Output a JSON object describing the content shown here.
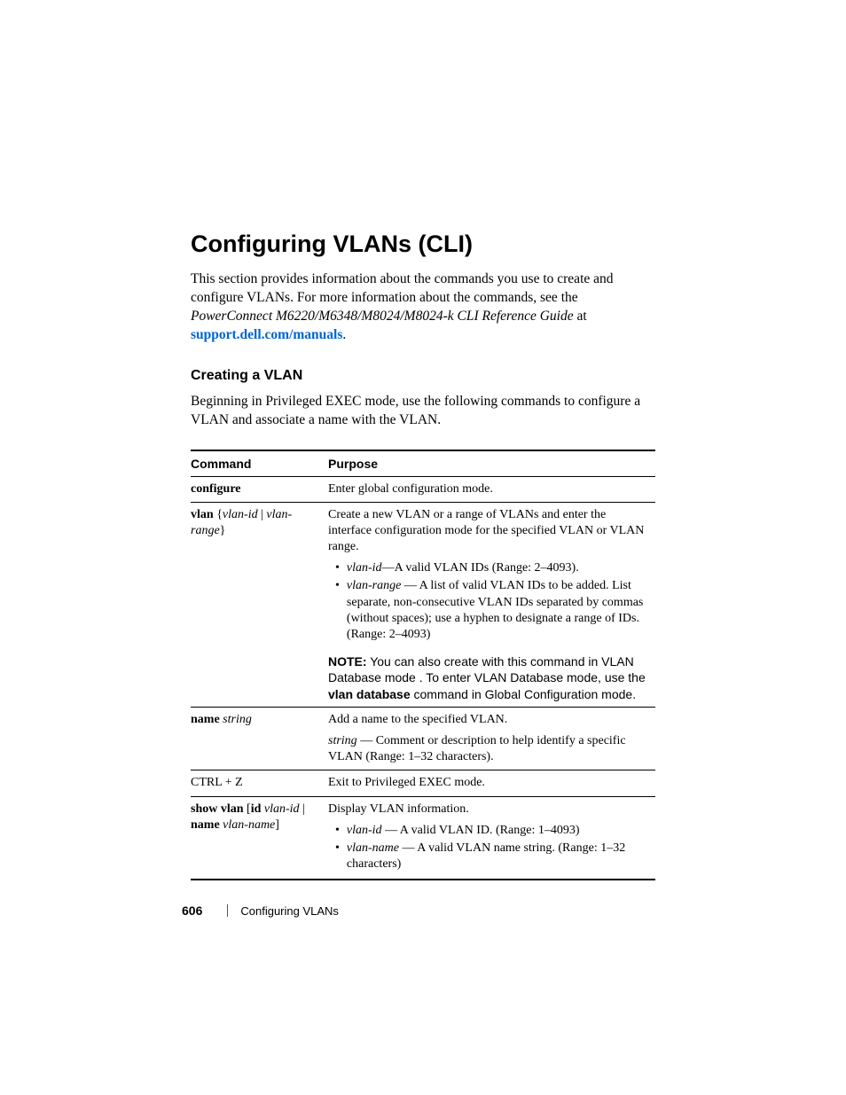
{
  "heading": "Configuring VLANs (CLI)",
  "intro": {
    "line1": "This section provides information about the commands you use to create and configure VLANs. For more information about the commands, see the ",
    "ref_italic": "PowerConnect M6220/M6348/M8024/M8024-k CLI Reference Guide",
    "line1_tail": " at ",
    "link": "support.dell.com/manuals",
    "period": "."
  },
  "subheading": "Creating a VLAN",
  "subpara": "Beginning in Privileged EXEC mode, use the following commands to configure a VLAN and associate a name with the VLAN.",
  "table": {
    "head": {
      "command": "Command",
      "purpose": "Purpose"
    },
    "row1": {
      "cmd": "configure",
      "purpose": "Enter global configuration mode."
    },
    "row2": {
      "cmd_bold1": "vlan",
      "cmd_brace_open": " {",
      "cmd_italic1": "vlan-id",
      "cmd_pipe": " | ",
      "cmd_italic2": "vlan-range",
      "cmd_brace_close": "}",
      "purpose_main": "Create a new VLAN or a range of VLANs and enter the interface configuration mode for the specified VLAN or VLAN range.",
      "bullet1_italic": "vlan-id",
      "bullet1_rest": "—A valid VLAN IDs (Range: 2–4093).",
      "bullet2_italic": "vlan-range",
      "bullet2_rest": " — A list of valid VLAN IDs to be added. List separate, non-consecutive VLAN IDs separated by commas (without spaces); use a hyphen to designate a range of IDs. (Range: 2–4093)",
      "note_bold": "NOTE:",
      "note_text1": " You can also create with this command in VLAN Database mode . To enter VLAN Database mode, use the ",
      "note_bold2": "vlan database",
      "note_text2": " command in Global Configuration mode."
    },
    "row3": {
      "cmd_bold": "name",
      "cmd_italic": " string",
      "purpose_main": "Add a name to the specified VLAN.",
      "def_italic": "string",
      "def_rest": " — Comment or description to help identify a specific VLAN (Range: 1–32 characters)."
    },
    "row4": {
      "cmd": "CTRL + Z",
      "purpose": "Exit to Privileged EXEC mode."
    },
    "row5": {
      "cmd_bold1": "show vlan",
      "cmd_plain1": " [",
      "cmd_bold2": "id",
      "cmd_italic1": " vlan-id",
      "cmd_plain2": " | ",
      "cmd_bold3": "name",
      "cmd_italic2": " vlan-name",
      "cmd_plain3": "]",
      "purpose_main": "Display VLAN information.",
      "bullet1_italic": "vlan-id",
      "bullet1_rest": " — A valid VLAN ID. (Range: 1–4093)",
      "bullet2_italic": "vlan-name",
      "bullet2_rest": " — A valid VLAN name string. (Range: 1–32 characters)"
    }
  },
  "footer": {
    "page": "606",
    "section": "Configuring VLANs"
  }
}
